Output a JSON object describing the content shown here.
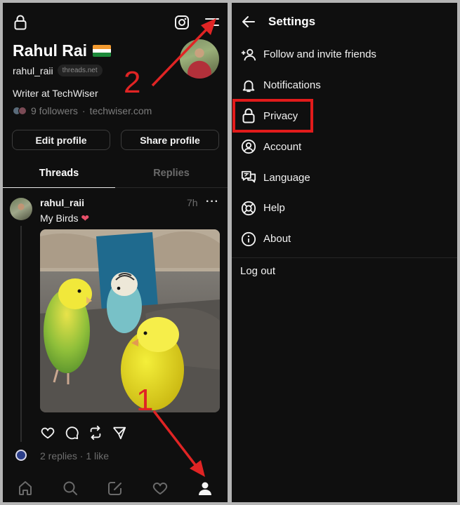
{
  "profile": {
    "name": "Rahul Rai",
    "handle": "rahul_raii",
    "domain_badge": "threads.net",
    "bio": "Writer at TechWiser",
    "followers": "9 followers",
    "separator": "·",
    "website": "techwiser.com",
    "edit_button": "Edit profile",
    "share_button": "Share profile"
  },
  "tabs": [
    {
      "label": "Threads",
      "active": true
    },
    {
      "label": "Replies",
      "active": false
    }
  ],
  "post": {
    "username": "rahul_raii",
    "time": "7h",
    "more": "···",
    "text": "My Birds",
    "stats": "2 replies · 1 like"
  },
  "annotations": {
    "step1": "1",
    "step2": "2",
    "color": "#e02424"
  },
  "settings": {
    "title": "Settings",
    "items": [
      {
        "label": "Follow and invite friends",
        "icon": "person-add-icon"
      },
      {
        "label": "Notifications",
        "icon": "bell-icon"
      },
      {
        "label": "Privacy",
        "icon": "lock-icon",
        "highlighted": true
      },
      {
        "label": "Account",
        "icon": "account-circle-icon"
      },
      {
        "label": "Language",
        "icon": "language-icon"
      },
      {
        "label": "Help",
        "icon": "lifebuoy-icon"
      },
      {
        "label": "About",
        "icon": "info-icon"
      }
    ],
    "logout": "Log out"
  },
  "colors": {
    "background": "#0f0f0f",
    "text": "#f3f3f3",
    "muted": "#6e6e6e",
    "highlight": "#e21b1b"
  }
}
